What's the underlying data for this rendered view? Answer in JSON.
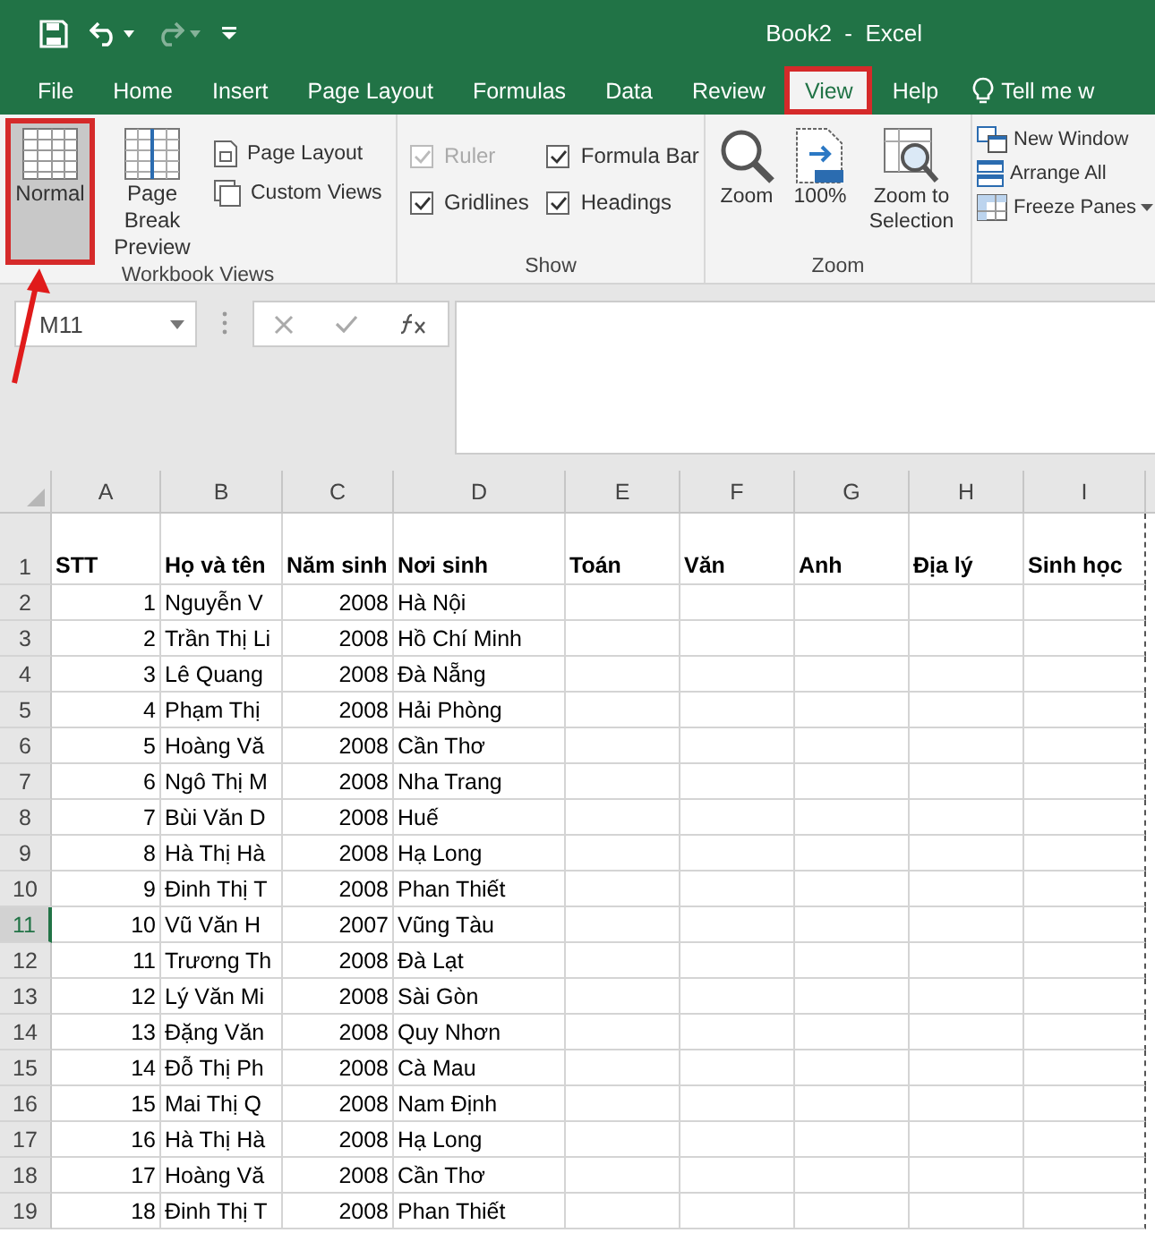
{
  "window": {
    "title": "Book2  -  Excel"
  },
  "tabs": [
    {
      "label": "File",
      "selected": false,
      "highlighted": false
    },
    {
      "label": "Home",
      "selected": false,
      "highlighted": false
    },
    {
      "label": "Insert",
      "selected": false,
      "highlighted": false
    },
    {
      "label": "Page Layout",
      "selected": false,
      "highlighted": false
    },
    {
      "label": "Formulas",
      "selected": false,
      "highlighted": false
    },
    {
      "label": "Data",
      "selected": false,
      "highlighted": false
    },
    {
      "label": "Review",
      "selected": false,
      "highlighted": false
    },
    {
      "label": "View",
      "selected": true,
      "highlighted": true
    },
    {
      "label": "Help",
      "selected": false,
      "highlighted": false
    }
  ],
  "tell_me": "Tell me w",
  "ribbon": {
    "groups": [
      {
        "kind": "views",
        "label": "Workbook Views",
        "items": [
          {
            "kind": "large",
            "label": "Normal",
            "selected": true,
            "highlighted": true
          },
          {
            "kind": "large",
            "label": "Page Break Preview",
            "selected": false,
            "highlighted": false
          },
          {
            "kind": "small",
            "label": "Page Layout"
          },
          {
            "kind": "small",
            "label": "Custom Views"
          }
        ]
      },
      {
        "kind": "show",
        "label": "Show",
        "items": [
          {
            "kind": "check",
            "label": "Ruler",
            "checked": true,
            "disabled": true
          },
          {
            "kind": "check",
            "label": "Gridlines",
            "checked": true,
            "disabled": false
          },
          {
            "kind": "check",
            "label": "Formula Bar",
            "checked": true,
            "disabled": false
          },
          {
            "kind": "check",
            "label": "Headings",
            "checked": true,
            "disabled": false
          }
        ]
      },
      {
        "kind": "zoom",
        "label": "Zoom",
        "items": [
          {
            "kind": "large",
            "label": "Zoom"
          },
          {
            "kind": "large",
            "label": "100%"
          },
          {
            "kind": "large",
            "label": "Zoom to Selection"
          }
        ]
      },
      {
        "kind": "window",
        "items": [
          {
            "kind": "small",
            "label": "New Window"
          },
          {
            "kind": "small",
            "label": "Arrange All"
          },
          {
            "kind": "small",
            "label": "Freeze Panes"
          }
        ]
      }
    ]
  },
  "name_box": {
    "value": "M11"
  },
  "sheet": {
    "columns": [
      {
        "label": "A",
        "kind": "number"
      },
      {
        "label": "B",
        "kind": "text"
      },
      {
        "label": "C",
        "kind": "number"
      },
      {
        "label": "D",
        "kind": "text"
      },
      {
        "label": "E",
        "kind": "text"
      },
      {
        "label": "F",
        "kind": "text"
      },
      {
        "label": "G",
        "kind": "text"
      },
      {
        "label": "H",
        "kind": "text"
      },
      {
        "label": "I",
        "kind": "text"
      }
    ],
    "rows": [
      {
        "header": "1",
        "kind": "header",
        "selected": false,
        "cells": [
          "STT",
          "Họ và tên",
          "Năm sinh",
          "Nơi sinh",
          "Toán",
          "Văn",
          "Anh",
          "Địa lý",
          "Sinh học"
        ]
      },
      {
        "header": "2",
        "kind": "data",
        "selected": false,
        "cells": [
          "1",
          "Nguyễn V",
          "2008",
          "Hà Nội"
        ]
      },
      {
        "header": "3",
        "kind": "data",
        "selected": false,
        "cells": [
          "2",
          "Trần Thị Li",
          "2008",
          "Hồ Chí Minh"
        ]
      },
      {
        "header": "4",
        "kind": "data",
        "selected": false,
        "cells": [
          "3",
          "Lê Quang",
          "2008",
          "Đà Nẵng"
        ]
      },
      {
        "header": "5",
        "kind": "data",
        "selected": false,
        "cells": [
          "4",
          "Phạm Thị",
          "2008",
          "Hải Phòng"
        ]
      },
      {
        "header": "6",
        "kind": "data",
        "selected": false,
        "cells": [
          "5",
          "Hoàng Vă",
          "2008",
          "Cần Thơ"
        ]
      },
      {
        "header": "7",
        "kind": "data",
        "selected": false,
        "cells": [
          "6",
          "Ngô Thị M",
          "2008",
          "Nha Trang"
        ]
      },
      {
        "header": "8",
        "kind": "data",
        "selected": false,
        "cells": [
          "7",
          "Bùi Văn D",
          "2008",
          "Huế"
        ]
      },
      {
        "header": "9",
        "kind": "data",
        "selected": false,
        "cells": [
          "8",
          "Hà Thị Hà",
          "2008",
          "Hạ Long"
        ]
      },
      {
        "header": "10",
        "kind": "data",
        "selected": false,
        "cells": [
          "9",
          "Đinh Thị T",
          "2008",
          "Phan Thiết"
        ]
      },
      {
        "header": "11",
        "kind": "data",
        "selected": true,
        "cells": [
          "10",
          "Vũ Văn H",
          "2007",
          "Vũng Tàu"
        ]
      },
      {
        "header": "12",
        "kind": "data",
        "selected": false,
        "cells": [
          "11",
          "Trương Th",
          "2008",
          "Đà Lạt"
        ]
      },
      {
        "header": "13",
        "kind": "data",
        "selected": false,
        "cells": [
          "12",
          "Lý Văn Mi",
          "2008",
          "Sài Gòn"
        ]
      },
      {
        "header": "14",
        "kind": "data",
        "selected": false,
        "cells": [
          "13",
          "Đặng Văn",
          "2008",
          "Quy Nhơn"
        ]
      },
      {
        "header": "15",
        "kind": "data",
        "selected": false,
        "cells": [
          "14",
          "Đỗ Thị Ph",
          "2008",
          "Cà Mau"
        ]
      },
      {
        "header": "16",
        "kind": "data",
        "selected": false,
        "cells": [
          "15",
          "Mai Thị Q",
          "2008",
          "Nam Định"
        ]
      },
      {
        "header": "17",
        "kind": "data",
        "selected": false,
        "cells": [
          "16",
          "Hà Thị Hà",
          "2008",
          "Hạ Long"
        ]
      },
      {
        "header": "18",
        "kind": "data",
        "selected": false,
        "cells": [
          "17",
          "Hoàng Vă",
          "2008",
          "Cần Thơ"
        ]
      },
      {
        "header": "19",
        "kind": "data",
        "selected": false,
        "cells": [
          "18",
          "Đinh Thị T",
          "2008",
          "Phan Thiết"
        ]
      }
    ]
  }
}
